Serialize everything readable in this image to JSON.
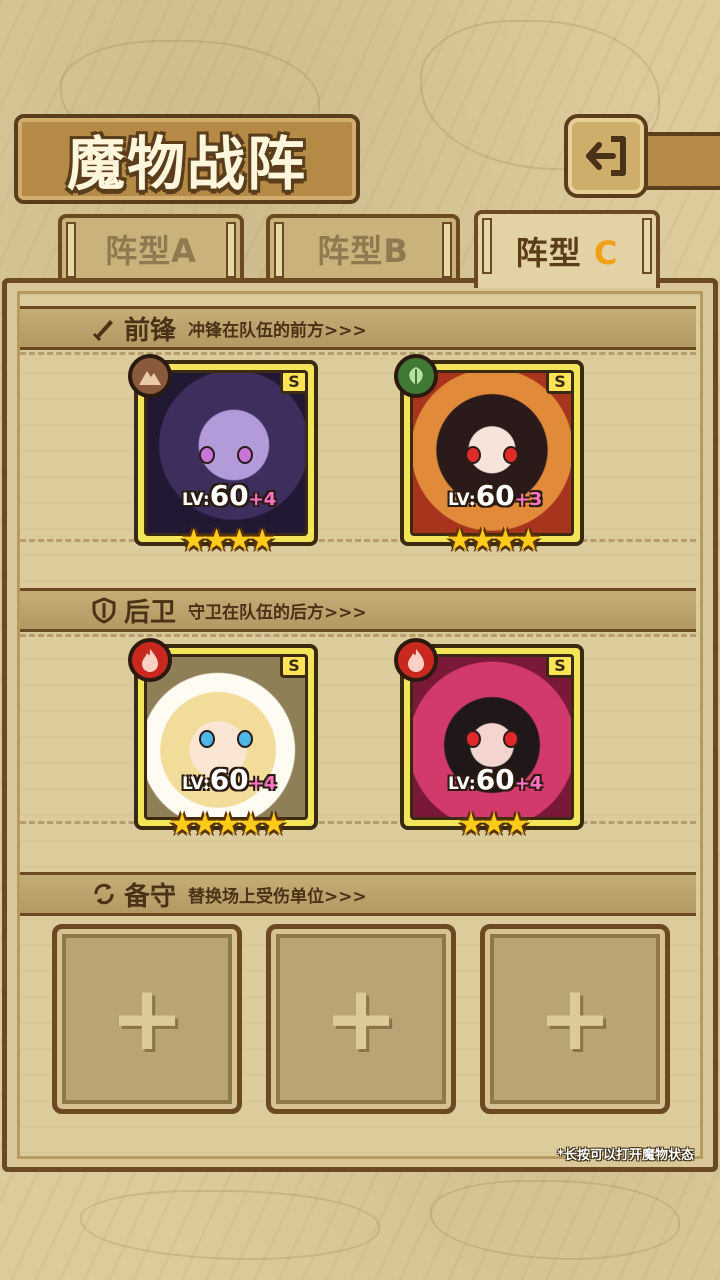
{
  "title": "魔物战阵",
  "tabs": [
    {
      "prefix": "阵型",
      "suffix": "A",
      "active": false
    },
    {
      "prefix": "阵型",
      "suffix": "B",
      "active": false
    },
    {
      "prefix": "阵型",
      "suffix": "C",
      "active": true
    }
  ],
  "sections": {
    "front": {
      "title": "前锋",
      "desc": "冲锋在队伍的前方>>>",
      "icon": "sword-icon"
    },
    "back": {
      "title": "后卫",
      "desc": "守卫在队伍的后方>>>",
      "icon": "shield-icon"
    },
    "reserve": {
      "title": "备守",
      "desc": "替换场上受伤单位>>>",
      "icon": "swap-icon"
    }
  },
  "cards": [
    {
      "element": "earth",
      "grade": "S",
      "lv_label": "LV:",
      "level": "60",
      "plus": "+4",
      "stars": "★★★★",
      "star_count": 4
    },
    {
      "element": "wood",
      "grade": "S",
      "lv_label": "LV:",
      "level": "60",
      "plus": "+3",
      "stars": "★★★★",
      "star_count": 4
    },
    {
      "element": "fire",
      "grade": "S",
      "lv_label": "LV:",
      "level": "60",
      "plus": "+4",
      "stars": "★★★★★",
      "star_count": 5
    },
    {
      "element": "fire",
      "grade": "S",
      "lv_label": "LV:",
      "level": "60",
      "plus": "+4",
      "stars": "★★★",
      "star_count": 3
    }
  ],
  "reserve_slots": [
    {
      "label": "+"
    },
    {
      "label": "+"
    },
    {
      "label": "+"
    }
  ],
  "hint": "*长按可以打开魔物状态",
  "colors": {
    "panel": "#dccb9b",
    "frame": "#6b4a22",
    "card": "#f2e55a",
    "active_tab_letter": "#f2a012",
    "level_plus": "#ff74c4"
  }
}
